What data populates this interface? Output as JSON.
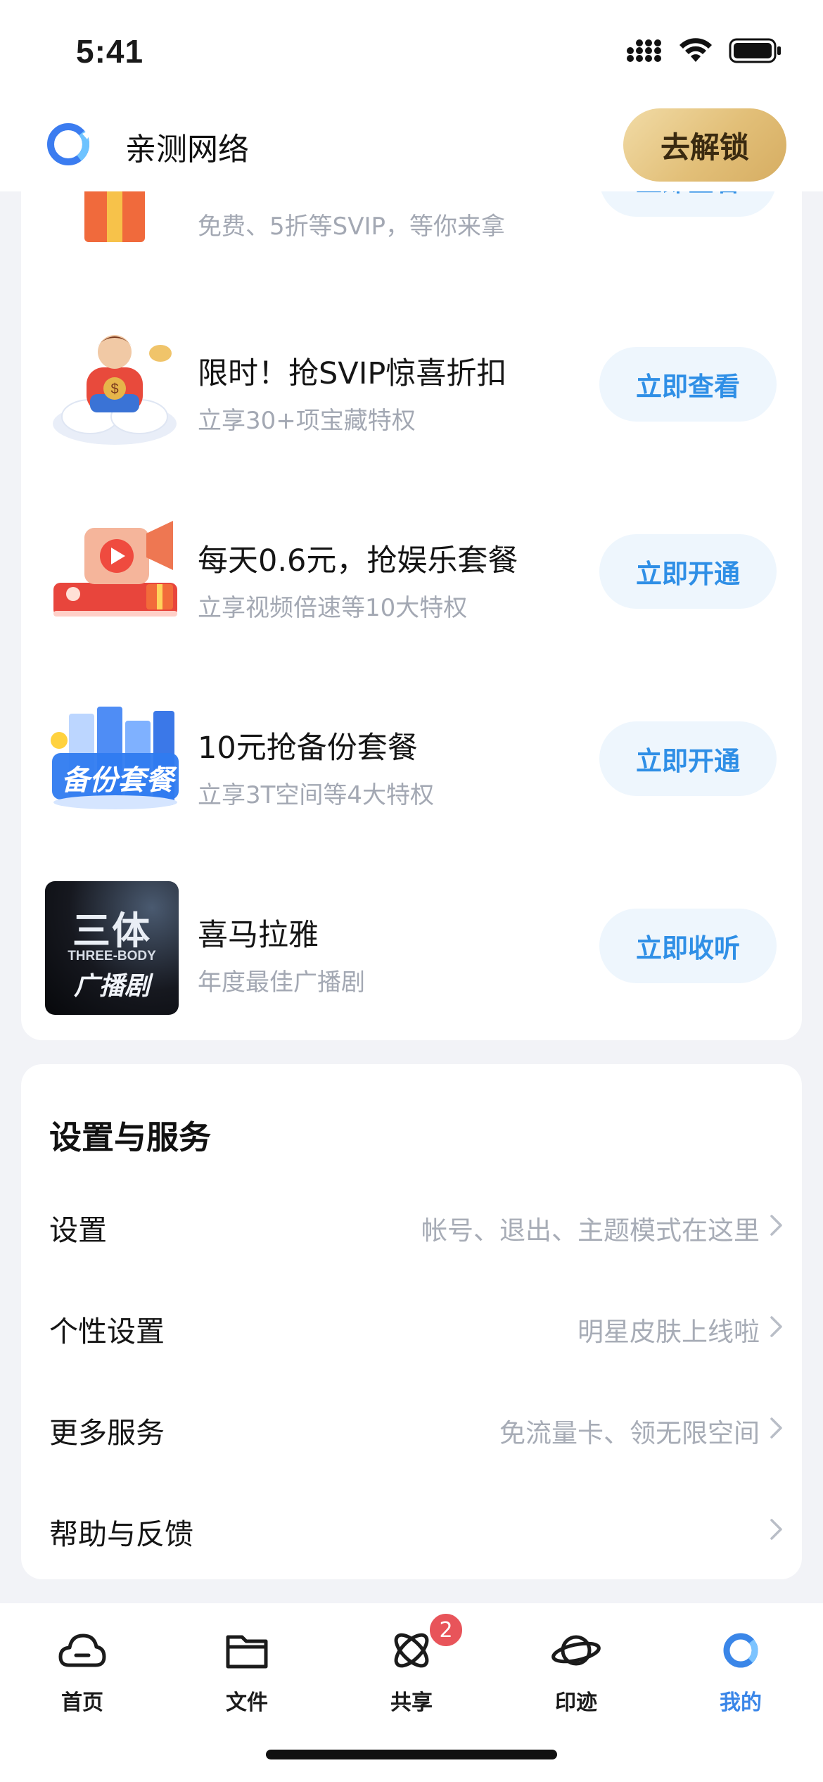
{
  "status_bar": {
    "time": "5:41"
  },
  "header": {
    "title": "亲测网络",
    "unlock_label": "去解锁"
  },
  "promotions": [
    {
      "title": "",
      "subtitle": "免费、5折等SVIP，等你来拿",
      "button": "立即查看",
      "icon": "gift-box-icon"
    },
    {
      "title": "限时！抢SVIP惊喜折扣",
      "subtitle": "立享30+项宝藏特权",
      "button": "立即查看",
      "icon": "svip-discount-illustration"
    },
    {
      "title": "每天0.6元，抢娱乐套餐",
      "subtitle": "立享视频倍速等10大特权",
      "button": "立即开通",
      "icon": "entertainment-package-illustration"
    },
    {
      "title": "10元抢备份套餐",
      "subtitle": "立享3T空间等4大特权",
      "button": "立即开通",
      "icon": "backup-package-illustration"
    },
    {
      "title": "喜马拉雅",
      "subtitle": "年度最佳广播剧",
      "button": "立即收听",
      "icon": "three-body-poster"
    }
  ],
  "poster": {
    "line1": "三体",
    "line2": "THREE-BODY",
    "line3": "广播剧"
  },
  "backup_thumb_text": "备份套餐",
  "settings": {
    "title": "设置与服务",
    "rows": [
      {
        "label": "设置",
        "hint": "帐号、退出、主题模式在这里"
      },
      {
        "label": "个性设置",
        "hint": "明星皮肤上线啦"
      },
      {
        "label": "更多服务",
        "hint": "免流量卡、领无限空间"
      },
      {
        "label": "帮助与反馈",
        "hint": ""
      }
    ]
  },
  "tabs": [
    {
      "label": "首页",
      "icon": "cloud-icon"
    },
    {
      "label": "文件",
      "icon": "folder-icon"
    },
    {
      "label": "共享",
      "icon": "share-orbit-icon",
      "badge": "2"
    },
    {
      "label": "印迹",
      "icon": "planet-icon"
    },
    {
      "label": "我的",
      "icon": "profile-logo-icon",
      "active": true
    }
  ],
  "colors": {
    "accent": "#3a86e8",
    "button_bg": "#eef6fd",
    "button_text": "#2f8fe6",
    "badge": "#e8545a",
    "gold": "#e2bf78"
  }
}
